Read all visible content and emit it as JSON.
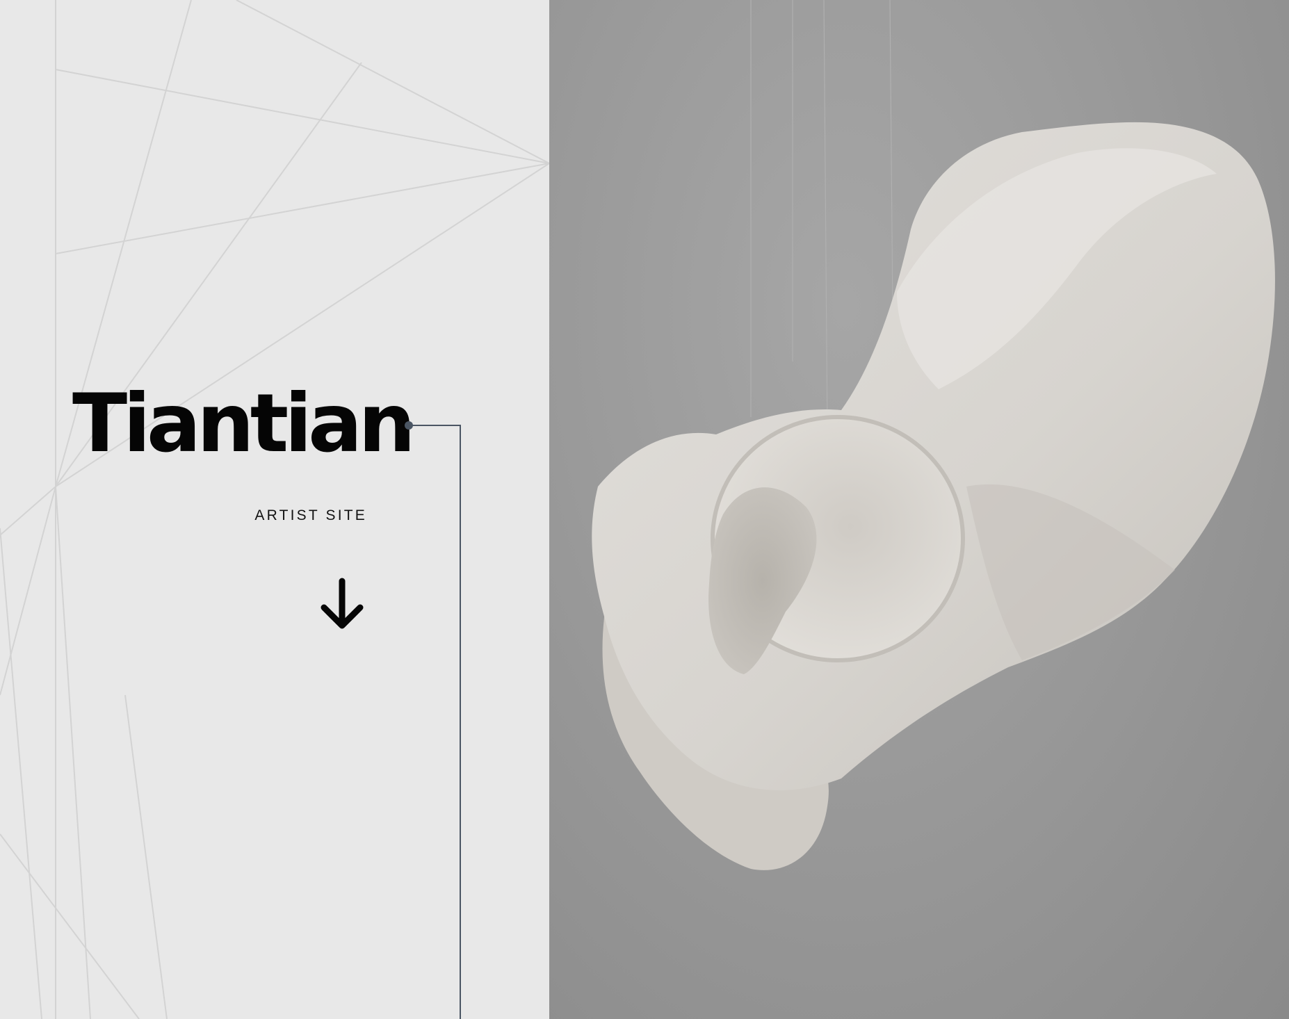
{
  "hero": {
    "title": "Tiantian",
    "tagline": "ARTIST SITE"
  },
  "icons": {
    "scroll": "arrow-down-icon"
  },
  "colors": {
    "left_background": "#e8e8e8",
    "title": "#050505",
    "connector": "#4a5563",
    "photo_background": "#9c9c9c",
    "sculpture": "#dcd9d4"
  }
}
